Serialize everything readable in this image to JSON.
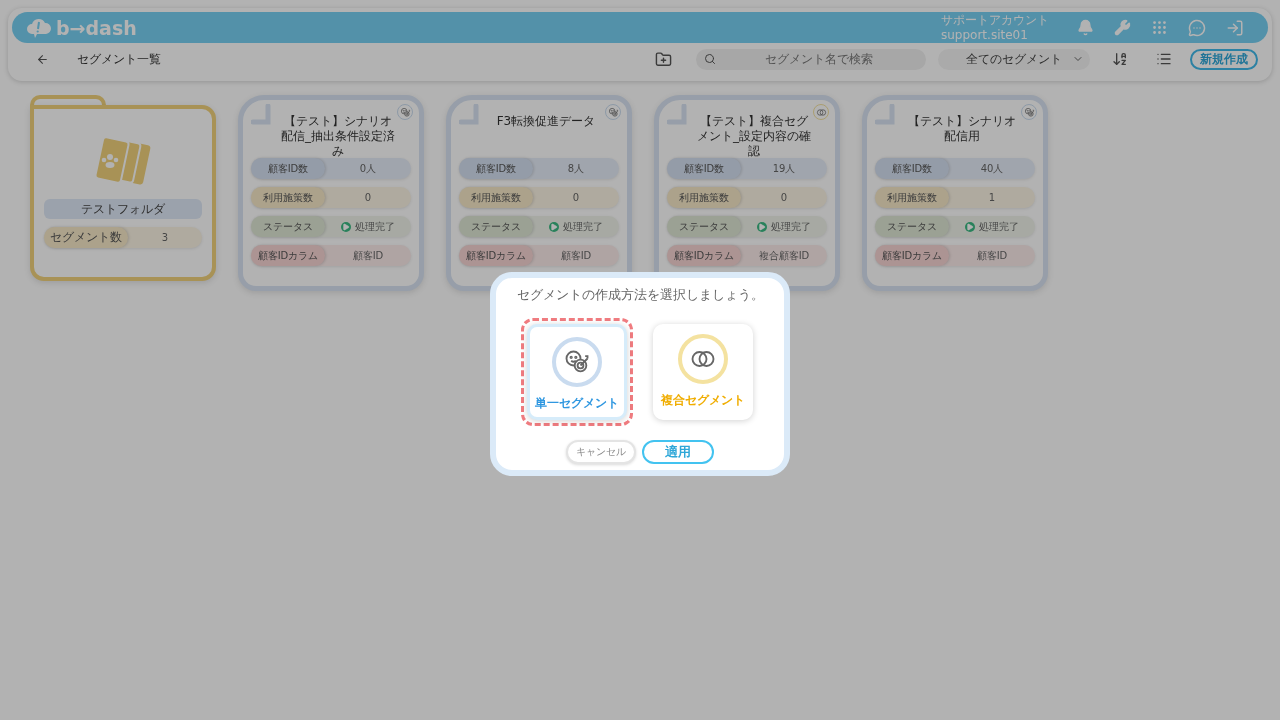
{
  "header": {
    "logo": "b→dash",
    "account_name": "サポートアカウント",
    "account_id": "support.site01"
  },
  "toolbar": {
    "title": "セグメント一覧",
    "search": {
      "placeholder": "セグメント名で検索"
    },
    "filter": "全てのセグメント",
    "new_button": "新規作成"
  },
  "folders": [
    {
      "name": "テストフォルダ",
      "count_label": "セグメント数",
      "count": "3"
    }
  ],
  "segments": [
    {
      "title": "【テスト】シナリオ配信_抽出条件設定済み",
      "kind": "single",
      "rows": [
        {
          "label": "顧客ID数",
          "value": "0人"
        },
        {
          "label": "利用施策数",
          "value": "0"
        },
        {
          "label": "ステータス",
          "value": "処理完了"
        },
        {
          "label": "顧客IDカラム",
          "value": "顧客ID"
        }
      ]
    },
    {
      "title": "F3転換促進データ",
      "kind": "single",
      "rows": [
        {
          "label": "顧客ID数",
          "value": "8人"
        },
        {
          "label": "利用施策数",
          "value": "0"
        },
        {
          "label": "ステータス",
          "value": "処理完了"
        },
        {
          "label": "顧客IDカラム",
          "value": "顧客ID"
        }
      ]
    },
    {
      "title": "【テスト】複合セグメント_設定内容の確認",
      "kind": "composite",
      "rows": [
        {
          "label": "顧客ID数",
          "value": "19人"
        },
        {
          "label": "利用施策数",
          "value": "0"
        },
        {
          "label": "ステータス",
          "value": "処理完了"
        },
        {
          "label": "顧客IDカラム",
          "value": "複合顧客ID"
        }
      ]
    },
    {
      "title": "【テスト】シナリオ配信用",
      "kind": "single",
      "rows": [
        {
          "label": "顧客ID数",
          "value": "40人"
        },
        {
          "label": "利用施策数",
          "value": "1"
        },
        {
          "label": "ステータス",
          "value": "処理完了"
        },
        {
          "label": "顧客IDカラム",
          "value": "顧客ID"
        }
      ]
    }
  ],
  "dialog": {
    "title": "セグメントの作成方法を選択しましょう。",
    "options": [
      {
        "label": "単一セグメント",
        "kind": "single",
        "selected": true
      },
      {
        "label": "複合セグメント",
        "kind": "composite",
        "selected": false
      }
    ],
    "cancel": "キャンセル",
    "apply": "適用"
  }
}
